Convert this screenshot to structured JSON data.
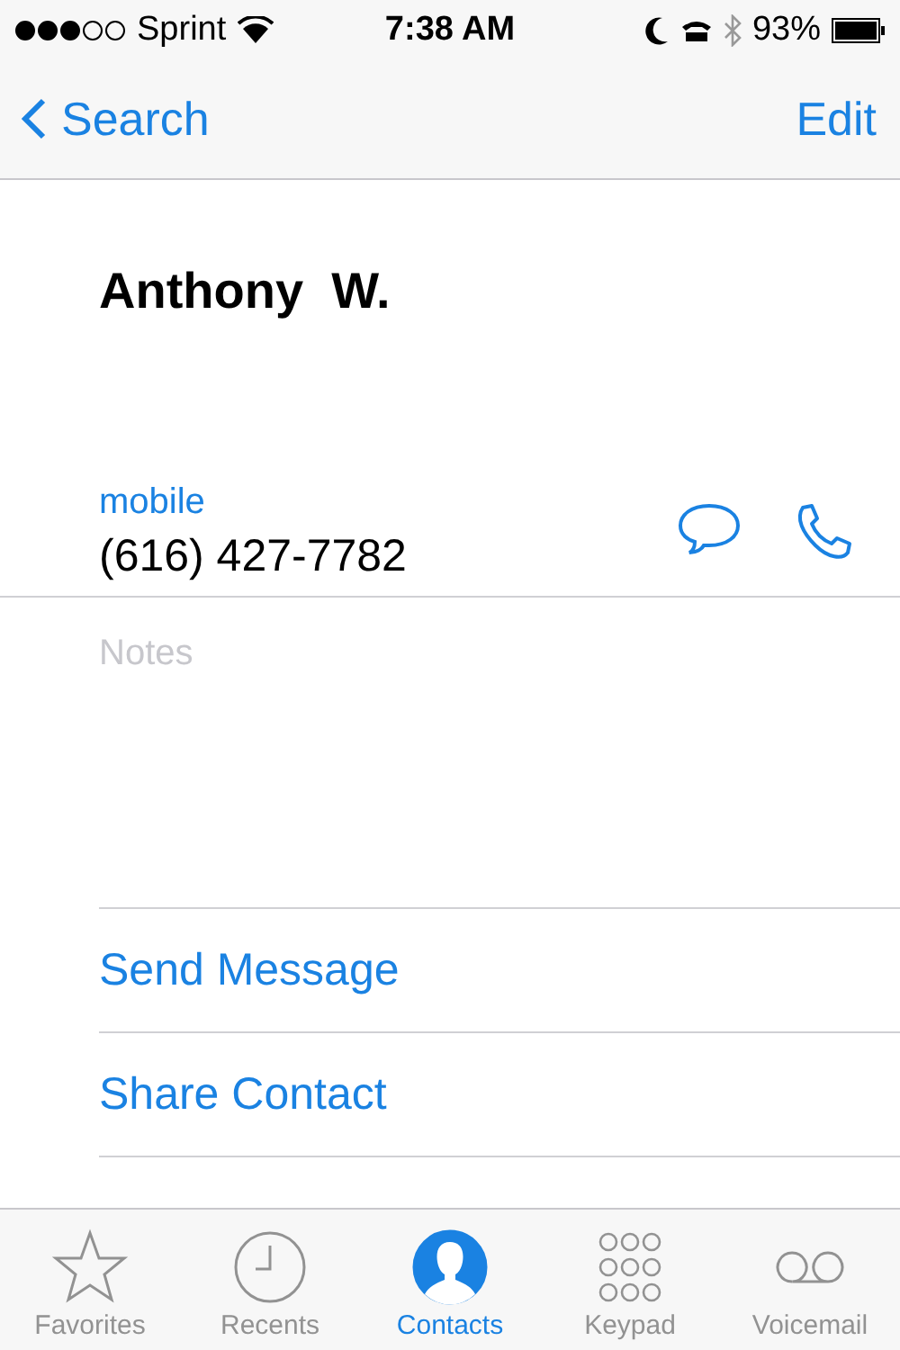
{
  "status_bar": {
    "carrier": "Sprint",
    "time": "7:38 AM",
    "battery": "93%"
  },
  "nav_bar": {
    "back": "Search",
    "action": "Edit"
  },
  "contact": {
    "name": "Anthony  W.",
    "phone_label": "mobile",
    "phone": "(616) 427-7782",
    "notes_placeholder": "Notes"
  },
  "actions": [
    "Send Message",
    "Share Contact"
  ],
  "tabs": [
    {
      "label": "Favorites",
      "kind": "star",
      "selected": false
    },
    {
      "label": "Recents",
      "kind": "clock",
      "selected": false
    },
    {
      "label": "Contacts",
      "kind": "person",
      "selected": true
    },
    {
      "label": "Keypad",
      "kind": "keypad",
      "selected": false
    },
    {
      "label": "Voicemail",
      "kind": "voicemail",
      "selected": false
    }
  ]
}
